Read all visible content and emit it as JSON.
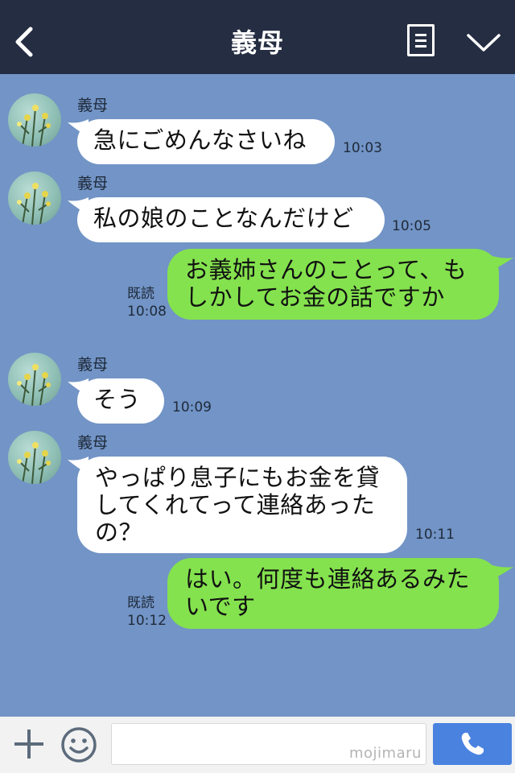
{
  "header": {
    "title": "義母"
  },
  "messages": [
    {
      "side": "in",
      "sender": "義母",
      "text": "急にごめんなさいね",
      "time": "10:03"
    },
    {
      "side": "in",
      "sender": "義母",
      "text": "私の娘のことなんだけど",
      "time": "10:05"
    },
    {
      "side": "out",
      "read": "既読",
      "text": "お義姉さんのことって、もしかしてお金の話ですか",
      "time": "10:08"
    },
    {
      "side": "in",
      "sender": "義母",
      "text": "そう",
      "time": "10:09"
    },
    {
      "side": "in",
      "sender": "義母",
      "text": "やっぱり息子にもお金を貸してくれてって連絡あったの？",
      "time": "10:11"
    },
    {
      "side": "out",
      "read": "既読",
      "text": "はい。何度も連絡あるみたいです",
      "time": "10:12"
    }
  ],
  "input": {
    "placeholder": "",
    "watermark": "mojimaru"
  },
  "colors": {
    "header": "#252d42",
    "background": "#7294c6",
    "incoming": "#ffffff",
    "outgoing": "#84e24e",
    "call_button": "#4a82e0"
  }
}
